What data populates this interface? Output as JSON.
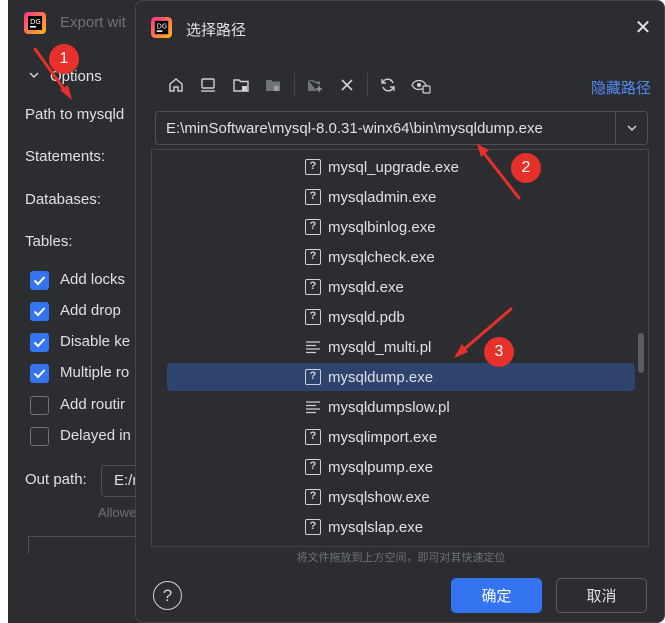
{
  "background_window": {
    "title": "Export wit",
    "options_label": "Options",
    "path_label": "Path to mysqld",
    "statements_label": "Statements:",
    "databases_label": "Databases:",
    "tables_label": "Tables:",
    "checkboxes": [
      {
        "label": "Add locks",
        "checked": true
      },
      {
        "label": "Add drop",
        "checked": true
      },
      {
        "label": "Disable ke",
        "checked": true
      },
      {
        "label": "Multiple ro",
        "checked": true
      },
      {
        "label": "Add routir",
        "checked": false
      },
      {
        "label": "Delayed in",
        "checked": false
      }
    ],
    "out_path_label": "Out path:",
    "out_path_value": "E:/r",
    "allowed_text": "Allowe"
  },
  "dialog": {
    "title": "选择路径",
    "hide_path_link": "隐藏路径",
    "toolbar_icons": [
      "home-icon",
      "desktop-icon",
      "project-folder-icon",
      "module-folder-icon",
      "new-folder-icon",
      "delete-icon",
      "refresh-icon",
      "show-hidden-icon"
    ],
    "path_value": "E:\\minSoftware\\mysql-8.0.31-winx64\\bin\\mysqldump.exe",
    "files": [
      {
        "name": "mysql_upgrade.exe",
        "icon": "unknown-file-icon",
        "selected": false
      },
      {
        "name": "mysqladmin.exe",
        "icon": "unknown-file-icon",
        "selected": false
      },
      {
        "name": "mysqlbinlog.exe",
        "icon": "unknown-file-icon",
        "selected": false
      },
      {
        "name": "mysqlcheck.exe",
        "icon": "unknown-file-icon",
        "selected": false
      },
      {
        "name": "mysqld.exe",
        "icon": "unknown-file-icon",
        "selected": false
      },
      {
        "name": "mysqld.pdb",
        "icon": "unknown-file-icon",
        "selected": false
      },
      {
        "name": "mysqld_multi.pl",
        "icon": "text-file-icon",
        "selected": false
      },
      {
        "name": "mysqldump.exe",
        "icon": "unknown-file-icon",
        "selected": true
      },
      {
        "name": "mysqldumpslow.pl",
        "icon": "text-file-icon",
        "selected": false
      },
      {
        "name": "mysqlimport.exe",
        "icon": "unknown-file-icon",
        "selected": false
      },
      {
        "name": "mysqlpump.exe",
        "icon": "unknown-file-icon",
        "selected": false
      },
      {
        "name": "mysqlshow.exe",
        "icon": "unknown-file-icon",
        "selected": false
      },
      {
        "name": "mysqlslap.exe",
        "icon": "unknown-file-icon",
        "selected": false
      }
    ],
    "drop_hint": "将文件拖放到上方空间，即可对其快速定位",
    "help_label": "?",
    "ok_label": "确定",
    "cancel_label": "取消"
  },
  "annotations": [
    "1",
    "2",
    "3"
  ],
  "colors": {
    "accent": "#3574f0",
    "link": "#548af7",
    "selected_row": "#2e436e",
    "annotation": "#e8302a",
    "background": "#2b2d30"
  }
}
